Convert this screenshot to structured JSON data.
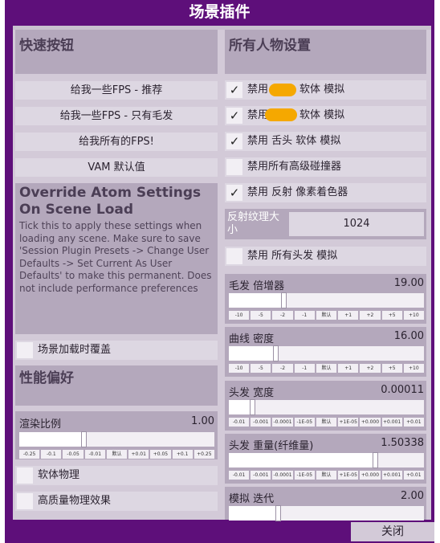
{
  "window": {
    "title": "场景插件"
  },
  "left": {
    "quick": {
      "title": "快速按钮",
      "buttons": [
        "给我一些FPS - 推荐",
        "给我一些FPS - 只有毛发",
        "给我所有的FPS!",
        "VAM 默认值"
      ]
    },
    "override": {
      "title": "Override Atom Settings On Scene Load",
      "desc": "Tick this to apply these settings when loading any scene. Make sure to save 'Session Plugin Presets -> Change User Defaults -> Set Current As User Defaults' to make this permanent. Does not include performance preferences",
      "toggle": {
        "label": "场景加载时覆盖",
        "checked": false
      }
    },
    "perf": {
      "title": "性能偏好",
      "render_scale": {
        "label": "渲染比例",
        "value": "1.00",
        "level": 0.33,
        "ticks": [
          "-0.25",
          "-0.1",
          "-0.05",
          "-0.01",
          "默认",
          "+0.01",
          "+0.05",
          "+0.1",
          "+0.25"
        ]
      },
      "toggles": [
        {
          "label": "软体物理",
          "checked": false
        },
        {
          "label": "高质量物理效果",
          "checked": false
        }
      ]
    }
  },
  "right": {
    "title": "所有人物设置",
    "toggles": [
      {
        "label": "禁用",
        "suffix": "软体 模拟",
        "checked": true
      },
      {
        "label": "禁用",
        "suffix": "软体 模拟",
        "checked": true
      },
      {
        "label": "禁用 舌头 软体 模拟",
        "checked": true
      },
      {
        "label": "禁用所有高级碰撞器",
        "checked": false
      },
      {
        "label": "禁用 反射 像素着色器",
        "checked": true
      }
    ],
    "reflection": {
      "label": "反射纹理大小",
      "value": "1024"
    },
    "hair_toggle": {
      "label": "禁用 所有头发 模拟",
      "checked": false
    },
    "sliders": [
      {
        "label": "毛发 倍增器",
        "value": "19.00",
        "level": 0.28,
        "ticks": [
          "-10",
          "-5",
          "-2",
          "-1",
          "默认",
          "+1",
          "+2",
          "+5",
          "+10"
        ]
      },
      {
        "label": "曲线 密度",
        "value": "16.00",
        "level": 0.24,
        "ticks": [
          "-10",
          "-5",
          "-2",
          "-1",
          "默认",
          "+1",
          "+2",
          "+5",
          "+10"
        ]
      },
      {
        "label": "头发 宽度",
        "value": "0.00011",
        "level": 0.12,
        "ticks": [
          "-0.01",
          "-0.001",
          "-0.0001",
          "-1E-05",
          "默认",
          "+1E-05",
          "+0.000",
          "+0.001",
          "+0.01"
        ]
      },
      {
        "label": "头发 重量(纤维量)",
        "value": "1.50338",
        "level": 0.75,
        "ticks": [
          "-0.01",
          "-0.001",
          "-0.0001",
          "-1E-05",
          "默认",
          "+1E-05",
          "+0.000",
          "+0.001",
          "+0.01"
        ]
      },
      {
        "label": "模拟 迭代",
        "value": "2.00",
        "level": 0.25,
        "ticks": []
      }
    ]
  },
  "footer": {
    "close": "关闭"
  },
  "colors": {
    "frame": "#5e0f7a",
    "panel": "#b4a8bc",
    "row": "#ddd7e2",
    "redact": "#f5a800"
  }
}
